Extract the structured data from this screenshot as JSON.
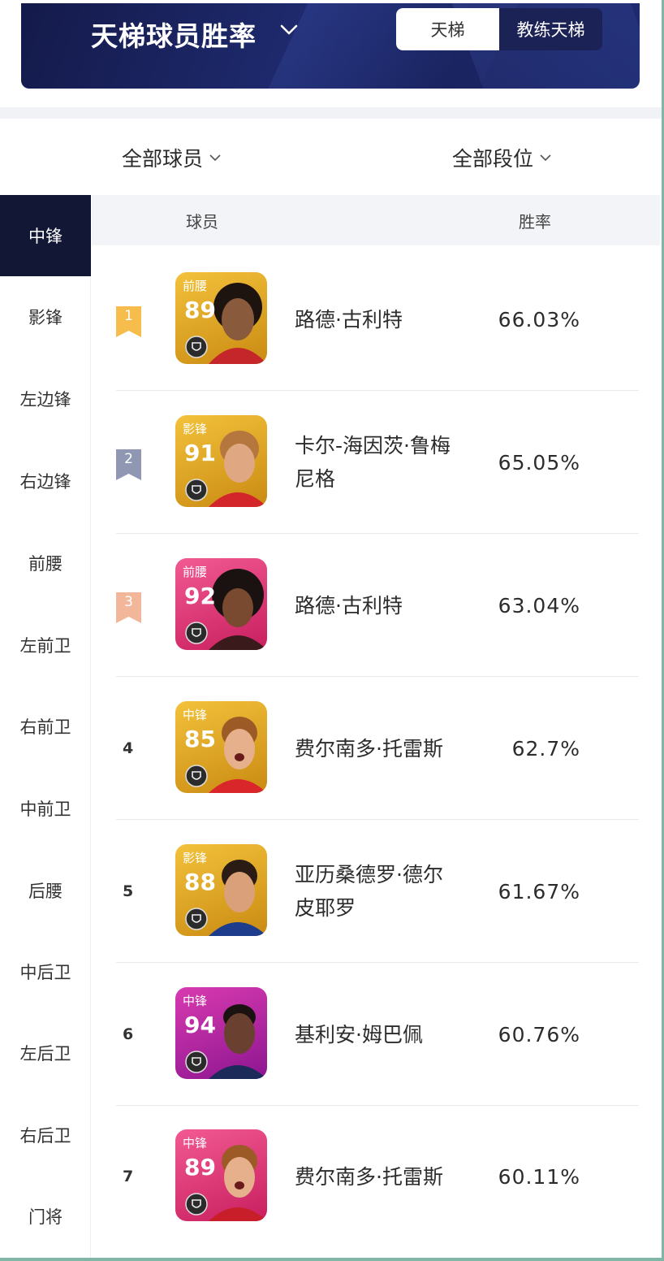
{
  "header": {
    "title": "天梯球员胜率",
    "tabs": [
      {
        "label": "天梯",
        "active": true
      },
      {
        "label": "教练天梯",
        "active": false
      }
    ]
  },
  "filters": {
    "players": "全部球员",
    "ranks": "全部段位"
  },
  "sidebar": {
    "items": [
      {
        "label": "中锋",
        "active": true
      },
      {
        "label": "影锋",
        "active": false
      },
      {
        "label": "左边锋",
        "active": false
      },
      {
        "label": "右边锋",
        "active": false
      },
      {
        "label": "前腰",
        "active": false
      },
      {
        "label": "左前卫",
        "active": false
      },
      {
        "label": "右前卫",
        "active": false
      },
      {
        "label": "中前卫",
        "active": false
      },
      {
        "label": "后腰",
        "active": false
      },
      {
        "label": "中后卫",
        "active": false
      },
      {
        "label": "左后卫",
        "active": false
      },
      {
        "label": "右后卫",
        "active": false
      },
      {
        "label": "门将",
        "active": false
      }
    ]
  },
  "table": {
    "columns": {
      "player": "球员",
      "rate": "胜率"
    },
    "rows": [
      {
        "rank": "1",
        "position": "前腰",
        "rating": "89",
        "name": "路德·古利特",
        "rate": "66.03%",
        "card_color": "gold"
      },
      {
        "rank": "2",
        "position": "影锋",
        "rating": "91",
        "name": "卡尔-海因茨·鲁梅尼格",
        "rate": "65.05%",
        "card_color": "gold"
      },
      {
        "rank": "3",
        "position": "前腰",
        "rating": "92",
        "name": "路德·古利特",
        "rate": "63.04%",
        "card_color": "pink"
      },
      {
        "rank": "4",
        "position": "中锋",
        "rating": "85",
        "name": "费尔南多·托雷斯",
        "rate": "62.7%",
        "card_color": "gold"
      },
      {
        "rank": "5",
        "position": "影锋",
        "rating": "88",
        "name": "亚历桑德罗·德尔皮耶罗",
        "rate": "61.67%",
        "card_color": "gold"
      },
      {
        "rank": "6",
        "position": "中锋",
        "rating": "94",
        "name": "基利安·姆巴佩",
        "rate": "60.76%",
        "card_color": "magenta"
      },
      {
        "rank": "7",
        "position": "中锋",
        "rating": "89",
        "name": "费尔南多·托雷斯",
        "rate": "60.11%",
        "card_color": "pink"
      }
    ]
  },
  "colors": {
    "banner": "#17205a",
    "sidebar_active": "#121735",
    "rank1": "#f7bd4c",
    "rank2": "#8f97b3",
    "rank3": "#f2b79a",
    "card_gold": "#e0a21a",
    "card_pink": "#e83a7a",
    "card_magenta": "#c0208f"
  }
}
